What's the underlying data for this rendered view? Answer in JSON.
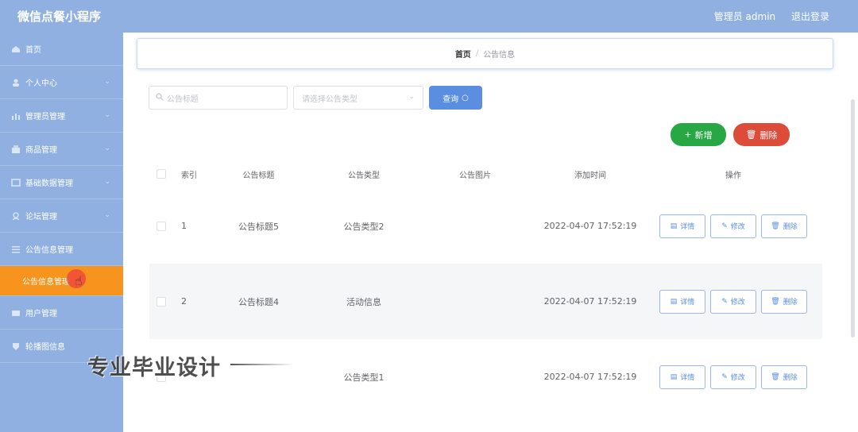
{
  "app": {
    "title": "微信点餐小程序"
  },
  "header": {
    "user_label": "管理员 admin",
    "logout_label": "退出登录"
  },
  "sidebar": {
    "items": [
      {
        "label": "首页",
        "icon": "home-icon",
        "has_chevron": false
      },
      {
        "label": "个人中心",
        "icon": "user-icon",
        "has_chevron": true
      },
      {
        "label": "管理员管理",
        "icon": "bar-chart-icon",
        "has_chevron": true
      },
      {
        "label": "商品管理",
        "icon": "goods-icon",
        "has_chevron": true
      },
      {
        "label": "基础数据管理",
        "icon": "database-icon",
        "has_chevron": true
      },
      {
        "label": "论坛管理",
        "icon": "forum-icon",
        "has_chevron": true
      },
      {
        "label": "公告信息管理",
        "icon": "list-icon",
        "has_chevron": false
      },
      {
        "label": "公告信息管理",
        "icon": "",
        "sub": true,
        "active": true
      },
      {
        "label": "用户管理",
        "icon": "users-icon",
        "has_chevron": false
      },
      {
        "label": "轮播图信息",
        "icon": "image-icon",
        "has_chevron": false
      }
    ],
    "active_color": "#f7941d"
  },
  "breadcrumb": {
    "home": "首页",
    "separator": "/",
    "current": "公告信息"
  },
  "search": {
    "title_placeholder": "公告标题",
    "type_placeholder": "请选择公告类型",
    "query_label": "查询"
  },
  "actions": {
    "add_label": "新增",
    "delete_label": "删除"
  },
  "table": {
    "headers": [
      "索引",
      "公告标题",
      "公告类型",
      "公告图片",
      "添加时间",
      "操作"
    ],
    "rows": [
      {
        "index": "1",
        "title": "公告标题5",
        "type": "公告类型2",
        "image": "",
        "time": "2022-04-07 17:52:19"
      },
      {
        "index": "2",
        "title": "公告标题4",
        "type": "活动信息",
        "image": "",
        "time": "2022-04-07 17:52:19"
      },
      {
        "index": "",
        "title": "",
        "type": "公告类型1",
        "image": "",
        "time": "2022-04-07 17:52:19"
      }
    ],
    "row_actions": {
      "detail": "详情",
      "edit": "修改",
      "delete": "删除"
    }
  },
  "watermark": {
    "text": "专业毕业设计"
  },
  "colors": {
    "primary": "#5b8ee0",
    "success": "#28a745",
    "danger": "#dd4b39",
    "sidebar": "#8fb0e0"
  }
}
